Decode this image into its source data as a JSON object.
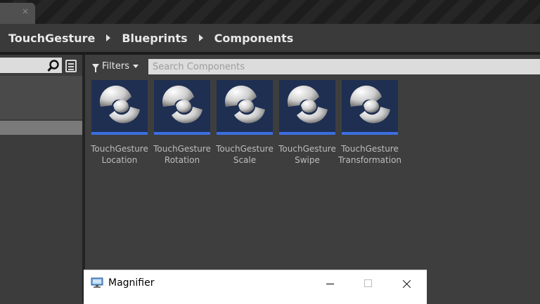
{
  "tab": {
    "close_glyph": "×"
  },
  "breadcrumb": {
    "items": [
      "TouchGesture",
      "Blueprints",
      "Components"
    ]
  },
  "toolbar": {
    "filters_label": "Filters",
    "search_placeholder": "Search Components"
  },
  "assets": [
    {
      "line1": "TouchGesture",
      "line2": "Location",
      "icon": "sphere-component-icon"
    },
    {
      "line1": "TouchGesture",
      "line2": "Rotation",
      "icon": "sphere-component-icon"
    },
    {
      "line1": "TouchGesture",
      "line2": "Scale",
      "icon": "sphere-component-icon"
    },
    {
      "line1": "TouchGesture",
      "line2": "Swipe",
      "icon": "sphere-component-icon"
    },
    {
      "line1": "TouchGesture",
      "line2": "Transformation",
      "icon": "sphere-component-icon"
    }
  ],
  "magnifier": {
    "title": "Magnifier"
  },
  "colors": {
    "asset_accent": "#3b6fe0",
    "asset_thumb_bg": "#1e2f52",
    "panel_bg": "#3e3e3e"
  }
}
